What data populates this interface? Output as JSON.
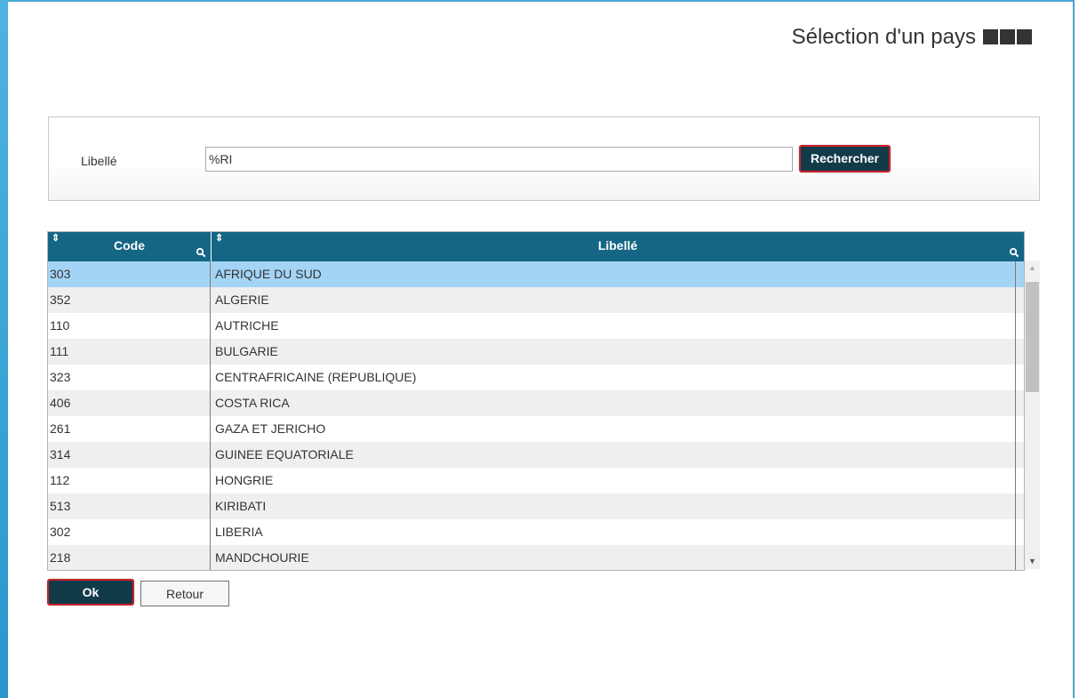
{
  "page": {
    "title": "Sélection d'un pays"
  },
  "search": {
    "label": "Libellé",
    "value": "%RI",
    "button_label": "Rechercher"
  },
  "grid": {
    "columns": [
      {
        "label": "Code"
      },
      {
        "label": "Libellé"
      }
    ],
    "sort_glyph": "⇕",
    "rows": [
      {
        "code": "303",
        "libelle": "AFRIQUE DU SUD",
        "selected": true
      },
      {
        "code": "352",
        "libelle": "ALGERIE"
      },
      {
        "code": "110",
        "libelle": "AUTRICHE"
      },
      {
        "code": "111",
        "libelle": "BULGARIE"
      },
      {
        "code": "323",
        "libelle": "CENTRAFRICAINE (REPUBLIQUE)"
      },
      {
        "code": "406",
        "libelle": "COSTA RICA"
      },
      {
        "code": "261",
        "libelle": "GAZA ET JERICHO"
      },
      {
        "code": "314",
        "libelle": "GUINEE EQUATORIALE"
      },
      {
        "code": "112",
        "libelle": "HONGRIE"
      },
      {
        "code": "513",
        "libelle": "KIRIBATI"
      },
      {
        "code": "302",
        "libelle": "LIBERIA"
      },
      {
        "code": "218",
        "libelle": "MANDCHOURIE"
      }
    ]
  },
  "actions": {
    "ok_label": "Ok",
    "retour_label": "Retour"
  },
  "colors": {
    "header_bg": "#156685",
    "button_bg": "#123b4a",
    "button_border": "#cc1f28",
    "selected_row": "#a4d4f5",
    "accent_bar": "#2a96cc"
  },
  "icons": {
    "search_icon": "magnifier",
    "sort_icon": "up-down-arrows",
    "scroll_up_icon": "triangle-up",
    "scroll_down_icon": "triangle-down",
    "title_decoration": "three-dark-squares"
  }
}
